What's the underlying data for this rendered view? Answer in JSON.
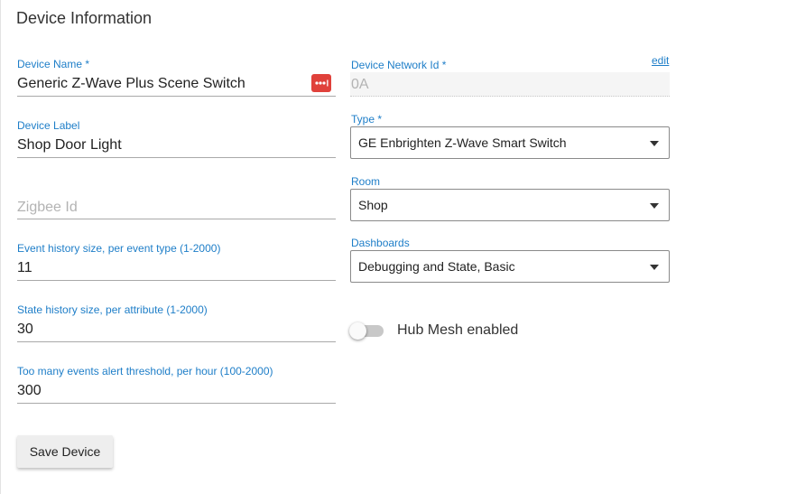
{
  "section": {
    "title": "Device Information"
  },
  "fields": {
    "device_name": {
      "label": "Device Name *",
      "value": "Generic Z-Wave Plus Scene Switch"
    },
    "device_label": {
      "label": "Device Label",
      "value": "Shop Door Light"
    },
    "zigbee_id": {
      "placeholder": "Zigbee Id"
    },
    "event_history": {
      "label": "Event history size, per event type (1-2000)",
      "value": "11"
    },
    "state_history": {
      "label": "State history size, per attribute (1-2000)",
      "value": "30"
    },
    "events_threshold": {
      "label": "Too many events alert threshold, per hour (100-2000)",
      "value": "300"
    },
    "network_id": {
      "label": "Device Network Id *",
      "value": "0A",
      "edit_label": "edit"
    },
    "type": {
      "label": "Type *",
      "value": "GE Enbrighten Z-Wave Smart Switch"
    },
    "room": {
      "label": "Room",
      "value": "Shop"
    },
    "dashboards": {
      "label": "Dashboards",
      "value": "Debugging and State, Basic"
    }
  },
  "hub_mesh": {
    "label": "Hub Mesh enabled",
    "enabled": false
  },
  "actions": {
    "save_label": "Save Device"
  },
  "colors": {
    "label_blue": "#1e7ec8",
    "password_button_red": "#e0413b"
  },
  "icons": {
    "password_manager": "password-dots-icon",
    "dropdown": "caret-down-icon"
  }
}
